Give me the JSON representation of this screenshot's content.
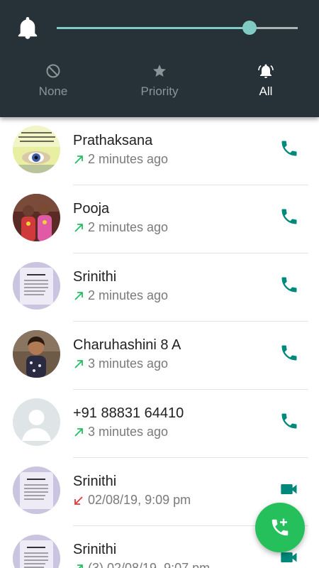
{
  "volume_panel": {
    "volume_level": 0.8,
    "modes": [
      {
        "label": "None",
        "icon": "do-not-disturb-icon",
        "active": false
      },
      {
        "label": "Priority",
        "icon": "star-icon",
        "active": false
      },
      {
        "label": "All",
        "icon": "bell-ringing-icon",
        "active": true
      }
    ]
  },
  "calls": [
    {
      "name": "Prathaksana",
      "detail": "2 minutes ago",
      "direction": "outgoing",
      "type": "voice",
      "avatar": "photo-quote-eye"
    },
    {
      "name": "Pooja",
      "detail": "2 minutes ago",
      "direction": "outgoing",
      "type": "voice",
      "avatar": "photo-kids"
    },
    {
      "name": "Srinithi",
      "detail": "2 minutes ago",
      "direction": "outgoing",
      "type": "voice",
      "avatar": "photo-one-day-quote"
    },
    {
      "name": "Charuhashini 8 A",
      "detail": "3 minutes ago",
      "direction": "outgoing",
      "type": "voice",
      "avatar": "photo-child"
    },
    {
      "name": "+91 88831 64410",
      "detail": "3 minutes ago",
      "direction": "outgoing",
      "type": "voice",
      "avatar": "default-contact"
    },
    {
      "name": "Srinithi",
      "detail": "02/08/19, 9:09 pm",
      "direction": "missed",
      "type": "video",
      "avatar": "photo-one-day-quote"
    },
    {
      "name": "Srinithi",
      "detail": "(3)  02/08/19, 9:07 pm",
      "direction": "outgoing",
      "type": "video",
      "avatar": "photo-one-day-quote"
    }
  ],
  "fab": {
    "icon": "new-call-icon"
  },
  "colors": {
    "panel_bg": "#263238",
    "accent_teal": "#00897b",
    "slider": "#80cbc4",
    "outgoing_arrow": "#21c063",
    "missed_arrow": "#e53935",
    "fab": "#25c05c"
  }
}
